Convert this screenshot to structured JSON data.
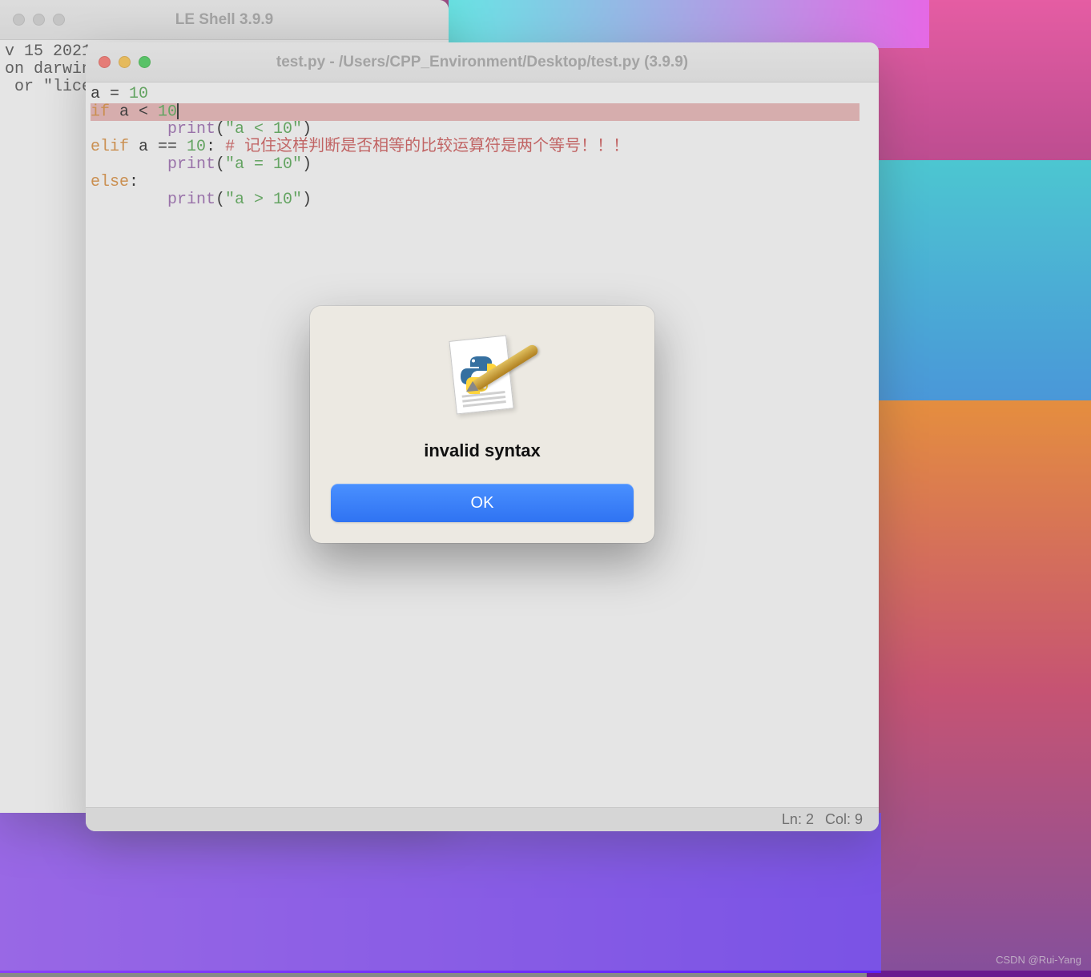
{
  "wallpaper": {
    "accent": "#ff2e9a"
  },
  "shell_window": {
    "title": "LE Shell 3.9.9",
    "body_lines": [
      "v 15 2021",
      "on darwin",
      " or \"lice"
    ]
  },
  "editor_window": {
    "title": "test.py - /Users/CPP_Environment/Desktop/test.py (3.9.9)",
    "code": {
      "l1": {
        "a": "a ",
        "eq": "= ",
        "n": "10"
      },
      "l2": {
        "kw": "if",
        "sp": " a ",
        "op": "< ",
        "n": "10"
      },
      "l3": {
        "indent": "        ",
        "fn": "print",
        "p1": "(",
        "s": "\"a < 10\"",
        "p2": ")"
      },
      "l4": {
        "kw": "elif",
        "sp": " a ",
        "op": "== ",
        "n": "10",
        "col": ": ",
        "cmt": "# 记住这样判断是否相等的比较运算符是两个等号！！！"
      },
      "l5": {
        "indent": "        ",
        "fn": "print",
        "p1": "(",
        "s": "\"a = 10\"",
        "p2": ")"
      },
      "l6": {
        "kw": "else",
        "col": ":"
      },
      "l7": {
        "indent": "        ",
        "fn": "print",
        "p1": "(",
        "s": "\"a > 10\"",
        "p2": ")"
      }
    },
    "status": {
      "line_label": "Ln: 2",
      "col_label": "Col: 9"
    }
  },
  "dialog": {
    "icon_name": "idle-document-pen-icon",
    "message": "invalid syntax",
    "ok_label": "OK"
  },
  "watermark": "CSDN @Rui-Yang"
}
